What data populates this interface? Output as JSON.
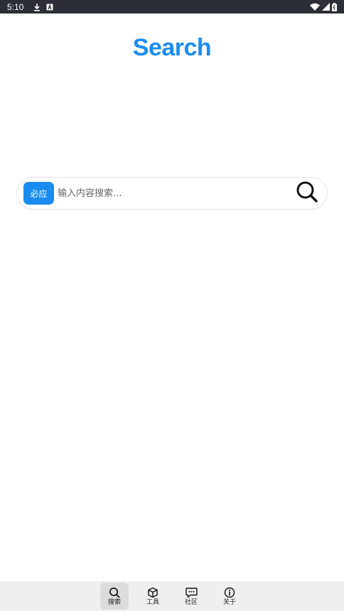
{
  "status_bar": {
    "time": "5:10",
    "left_icons": [
      "download-icon",
      "notification-a-icon"
    ],
    "right_icons": [
      "wifi-icon",
      "signal-icon",
      "battery-icon"
    ]
  },
  "app": {
    "title": "Search",
    "accent_color": "#1a8cf0"
  },
  "search": {
    "engine_label": "必应",
    "placeholder": "输入内容搜索...",
    "value": ""
  },
  "nav": {
    "items": [
      {
        "label": "搜索",
        "icon": "search-icon",
        "active": true
      },
      {
        "label": "工具",
        "icon": "cube-icon",
        "active": false
      },
      {
        "label": "社区",
        "icon": "chat-bubble-icon",
        "active": false
      },
      {
        "label": "关于",
        "icon": "info-icon",
        "active": false
      }
    ]
  }
}
